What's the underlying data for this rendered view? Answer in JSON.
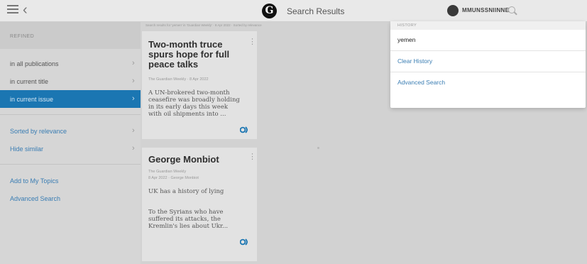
{
  "header": {
    "title": "Search Results",
    "logo_letter": "G",
    "account_name": "MMUNSSNIINNE"
  },
  "sidebar": {
    "header": "REFINED",
    "items": [
      {
        "label": "in all publications"
      },
      {
        "label": "in current title"
      },
      {
        "label": "in current issue"
      },
      {
        "label": "Sorted by relevance"
      },
      {
        "label": "Hide similar"
      }
    ],
    "links": [
      {
        "label": "Add to My Topics"
      },
      {
        "label": "Advanced Search"
      }
    ]
  },
  "results": {
    "breadcrumb": "Search results for 'yemen' in 'Guardian Weekly' · 8 Apr 2022 · Sorted by relevance",
    "articles": [
      {
        "title": "Two-month truce spurs hope for full peace talks",
        "meta": "The Guardian Weekly · 8 Apr 2022",
        "meta2": "",
        "body": "A UN-brokered two-month ceasefire was broadly holding in its early days this week with oil shipments into ..."
      },
      {
        "title": "George Monbiot",
        "meta": "The Guardian Weekly",
        "meta2": "8 Apr 2022 · George Monbiot",
        "subhead": "UK has a history of lying",
        "body": "To the Syrians who have suffered its attacks, the Kremlin's lies about Ukr..."
      }
    ]
  },
  "search_history": {
    "header": "HISTORY",
    "term": "yemen",
    "clear_label": "Clear History",
    "advanced_label": "Advanced Search"
  },
  "colors": {
    "active_row": "#1b76b2",
    "link": "#3a7db3"
  }
}
